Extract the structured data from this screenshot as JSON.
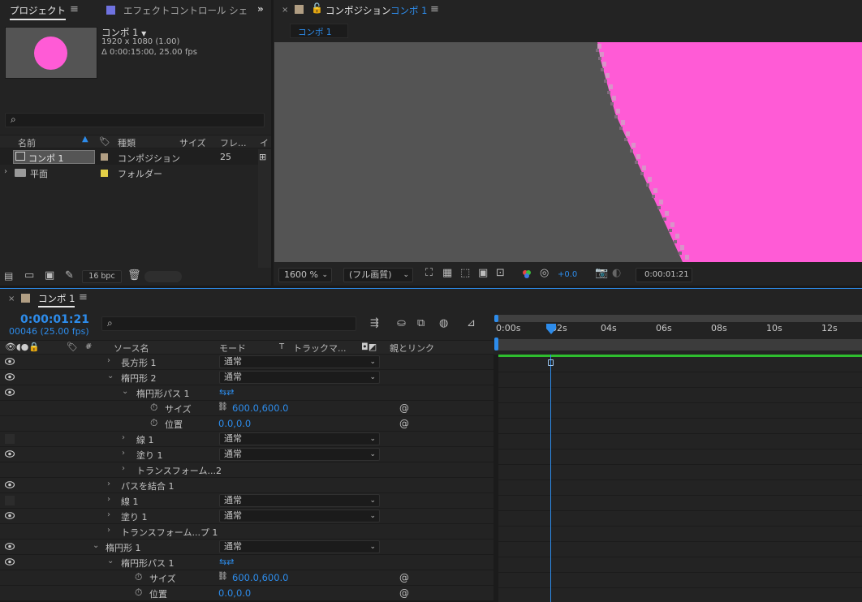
{
  "project": {
    "tab_label": "プロジェクト",
    "effect_tab_label": "エフェクトコントロール シェ",
    "comp_name": "コンポ 1",
    "comp_resolution": "1920 x 1080 (1.00)",
    "comp_duration": "Δ 0:00:15:00, 25.00 fps",
    "search_placeholder": "",
    "col_name": "名前",
    "col_type": "種類",
    "col_size": "サイズ",
    "col_frame": "フレ...",
    "col_extra": "イ",
    "items": [
      {
        "name": "コンポ 1",
        "type": "コンポジション",
        "frames": "25",
        "color": "#b19e83"
      },
      {
        "name": "平面",
        "type": "フォルダー",
        "frames": "",
        "color": "#e3cf47"
      }
    ],
    "bpc_label": "16 bpc"
  },
  "comp": {
    "tab_label": "コンポジション",
    "tab_comp": "コンポ 1",
    "subtab": "コンポ 1",
    "zoom": "1600 %",
    "quality": "(フル画質)",
    "exposure": "+0.0",
    "timecode": "0:00:01:21",
    "shape_color": "#ff5bd6",
    "bg_color": "#545454"
  },
  "timeline": {
    "tab_label": "コンポ 1",
    "current_time": "0:00:01:21",
    "frame_info": "00046 (25.00 fps)",
    "search_placeholder": "",
    "col_hash": "#",
    "col_source": "ソース名",
    "col_mode": "モード",
    "col_t": "T",
    "col_track": "トラックマ...",
    "col_parent": "親とリンク",
    "ruler": [
      "0:00s",
      "02s",
      "04s",
      "06s",
      "08s",
      "10s",
      "12s"
    ],
    "rows": [
      {
        "label": "長方形 1",
        "mode": "通常",
        "eye": true
      },
      {
        "label": "楕円形 2",
        "mode": "通常",
        "eye": true
      },
      {
        "label": "楕円形パス 1",
        "eye": true
      },
      {
        "label": "サイズ",
        "value": "600.0,600.0"
      },
      {
        "label": "位置",
        "value": "0.0,0.0"
      },
      {
        "label": "線 1",
        "mode": "通常",
        "eye": false
      },
      {
        "label": "塗り 1",
        "mode": "通常",
        "eye": true
      },
      {
        "label": "トランスフォーム...2"
      },
      {
        "label": "パスを結合 1",
        "eye": true
      },
      {
        "label": "線 1",
        "mode": "通常",
        "eye": false
      },
      {
        "label": "塗り 1",
        "mode": "通常",
        "eye": true
      },
      {
        "label": "トランスフォーム...プ 1"
      },
      {
        "label": "楕円形 1",
        "mode": "通常",
        "eye": true
      },
      {
        "label": "楕円形パス 1",
        "eye": true
      },
      {
        "label": "サイズ",
        "value": "600.0,600.0"
      },
      {
        "label": "位置",
        "value": "0.0,0.0"
      }
    ]
  }
}
